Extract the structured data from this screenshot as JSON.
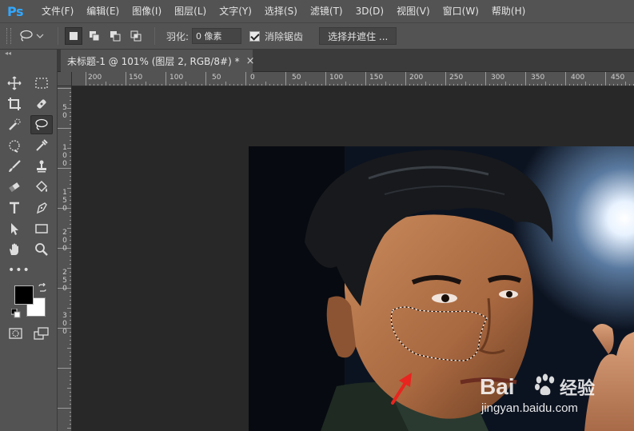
{
  "app": {
    "logo": "Ps"
  },
  "menu": [
    "文件(F)",
    "编辑(E)",
    "图像(I)",
    "图层(L)",
    "文字(Y)",
    "选择(S)",
    "滤镜(T)",
    "3D(D)",
    "视图(V)",
    "窗口(W)",
    "帮助(H)"
  ],
  "options": {
    "feather_label": "羽化:",
    "feather_value": "0 像素",
    "antialias_label": "消除锯齿",
    "antialias_checked": true,
    "select_mask_label": "选择并遮住 ..."
  },
  "document": {
    "tab_title": "未标题-1 @ 101% (图层 2, RGB/8#) *",
    "close_glyph": "×"
  },
  "ruler": {
    "top_labels": [
      "200",
      "150",
      "100",
      "50",
      "0",
      "50",
      "100",
      "150",
      "200",
      "250",
      "300",
      "350",
      "400",
      "450"
    ],
    "left_labels": [
      "5 0",
      "1 0 0",
      "1 5 0",
      "2 0 0",
      "2 5 0",
      "3 0 0"
    ]
  },
  "colors": {
    "foreground": "#000000",
    "background": "#ffffff",
    "ps_blue": "#31a8ff",
    "arrow": "#e8251f"
  },
  "tools": [
    "move-tool-icon",
    "marquee-tool-icon",
    "crop-tool-icon",
    "healing-brush-tool-icon",
    "quick-selection-tool-icon",
    "lasso-tool-icon",
    "spot-healing-tool-icon",
    "eyedropper-tool-icon",
    "brush-tool-icon",
    "clone-stamp-tool-icon",
    "eraser-tool-icon",
    "paint-bucket-tool-icon",
    "type-tool-icon",
    "pen-tool-icon",
    "path-selection-tool-icon",
    "rectangle-tool-icon",
    "hand-tool-icon",
    "zoom-tool-icon"
  ],
  "more_tools": "•••",
  "watermark": {
    "brand": "Bai",
    "brand2": "经验",
    "url": "jingyan.baidu.com"
  }
}
